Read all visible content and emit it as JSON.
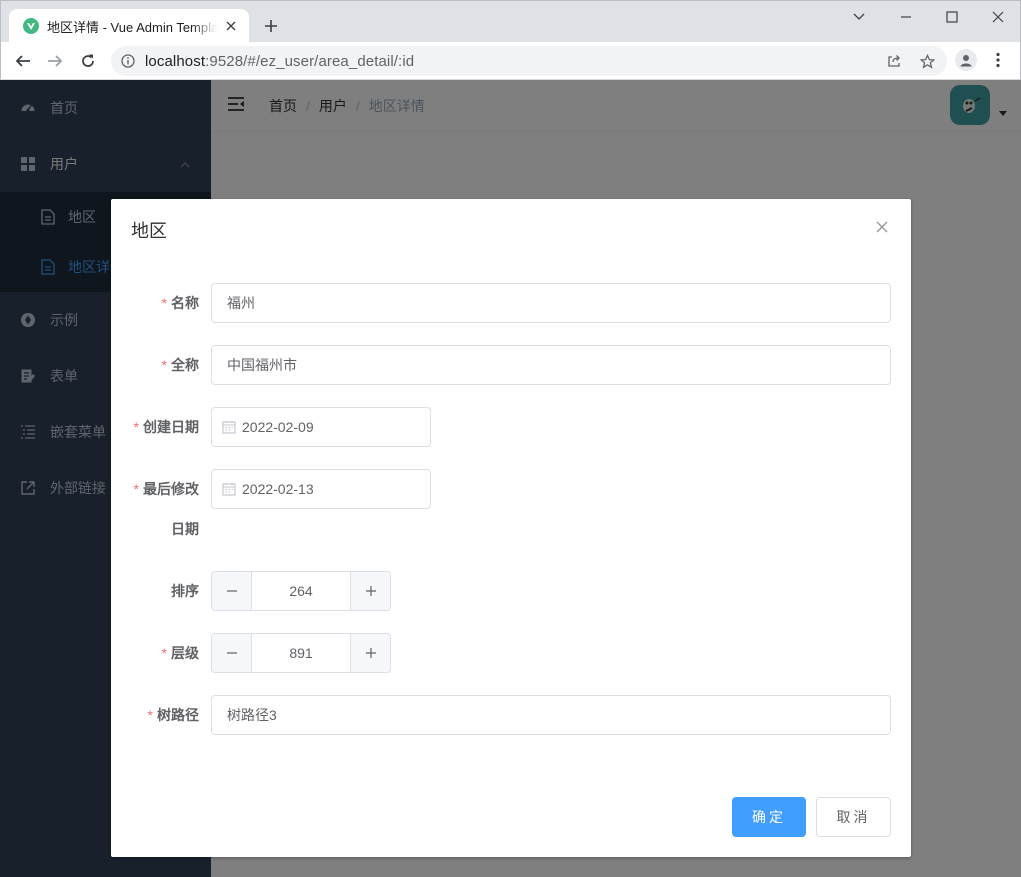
{
  "browser": {
    "tab_title": "地区详情 - Vue Admin Template",
    "url_host": "localhost",
    "url_rest": ":9528/#/ez_user/area_detail/:id"
  },
  "sidebar": {
    "items": [
      {
        "label": "首页",
        "icon": "dashboard-icon"
      },
      {
        "label": "用户",
        "icon": "grid-icon"
      },
      {
        "label": "示例",
        "icon": "example-icon"
      },
      {
        "label": "表单",
        "icon": "form-icon"
      },
      {
        "label": "嵌套菜单",
        "icon": "nested-icon"
      },
      {
        "label": "外部链接",
        "icon": "link-icon"
      }
    ],
    "sub_items": [
      {
        "label": "地区",
        "icon": "document-icon"
      },
      {
        "label": "地区详情",
        "icon": "document-icon",
        "active": true
      }
    ]
  },
  "breadcrumb": [
    "首页",
    "用户",
    "地区详情"
  ],
  "dialog": {
    "title": "地区",
    "fields": {
      "name": {
        "label": "名称",
        "value": "福州",
        "required": true
      },
      "full_name": {
        "label": "全称",
        "value": "中国福州市",
        "required": true
      },
      "created": {
        "label": "创建日期",
        "value": "2022-02-09",
        "required": true
      },
      "modified": {
        "label_line1": "最后修改",
        "label_line2": "日期",
        "value": "2022-02-13",
        "required": true
      },
      "sort": {
        "label": "排序",
        "value": "264",
        "required": false
      },
      "level": {
        "label": "层级",
        "value": "891",
        "required": true
      },
      "tree_path": {
        "label": "树路径",
        "value": "树路径3",
        "required": true
      }
    },
    "confirm_label": "确定",
    "cancel_label": "取消"
  },
  "colors": {
    "primary": "#409eff",
    "sidebar_bg": "#304156",
    "submenu_bg": "#1f2d3d",
    "required": "#f56c6c"
  }
}
